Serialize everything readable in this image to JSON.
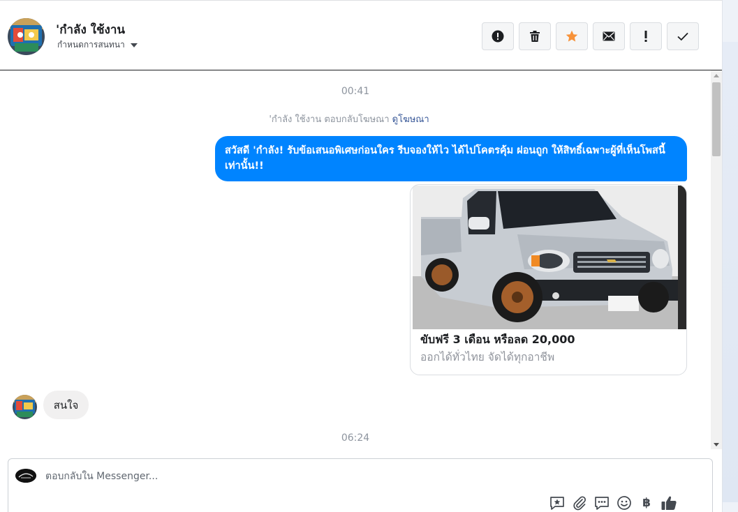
{
  "header": {
    "contact_name": "'กำลัง ใช้งาน",
    "conversation_settings": "กำหนดการสนทนา"
  },
  "thread": {
    "timestamp_1": "00:41",
    "ad_reply_text": "'กำลัง ใช้งาน ตอบกลับโฆษณา",
    "ad_view_link": "ดูโฆษณา",
    "outgoing_message": "สวัสดี 'กำลัง! รับข้อเสนอพิเศษก่อนใคร รีบจองให้ไว ได้ไปโคตรคุ้ม ผ่อนถูก ให้สิทธิ์เฉพาะผู้ที่เห็นโพสนี้เท่านั้น!!",
    "ad_card": {
      "title": "ขับฟรี 3 เดือน หรือลด 20,000",
      "subtitle": "ออกได้ทั่วไทย จัดได้ทุกอาชีพ"
    },
    "incoming_message": "สนใจ",
    "timestamp_2": "06:24"
  },
  "composer": {
    "placeholder": "ตอบกลับใน Messenger...",
    "currency_symbol": "฿"
  },
  "colors": {
    "accent": "#0084ff",
    "star": "#f7923a",
    "incoming_bubble": "#f1f0f0"
  }
}
